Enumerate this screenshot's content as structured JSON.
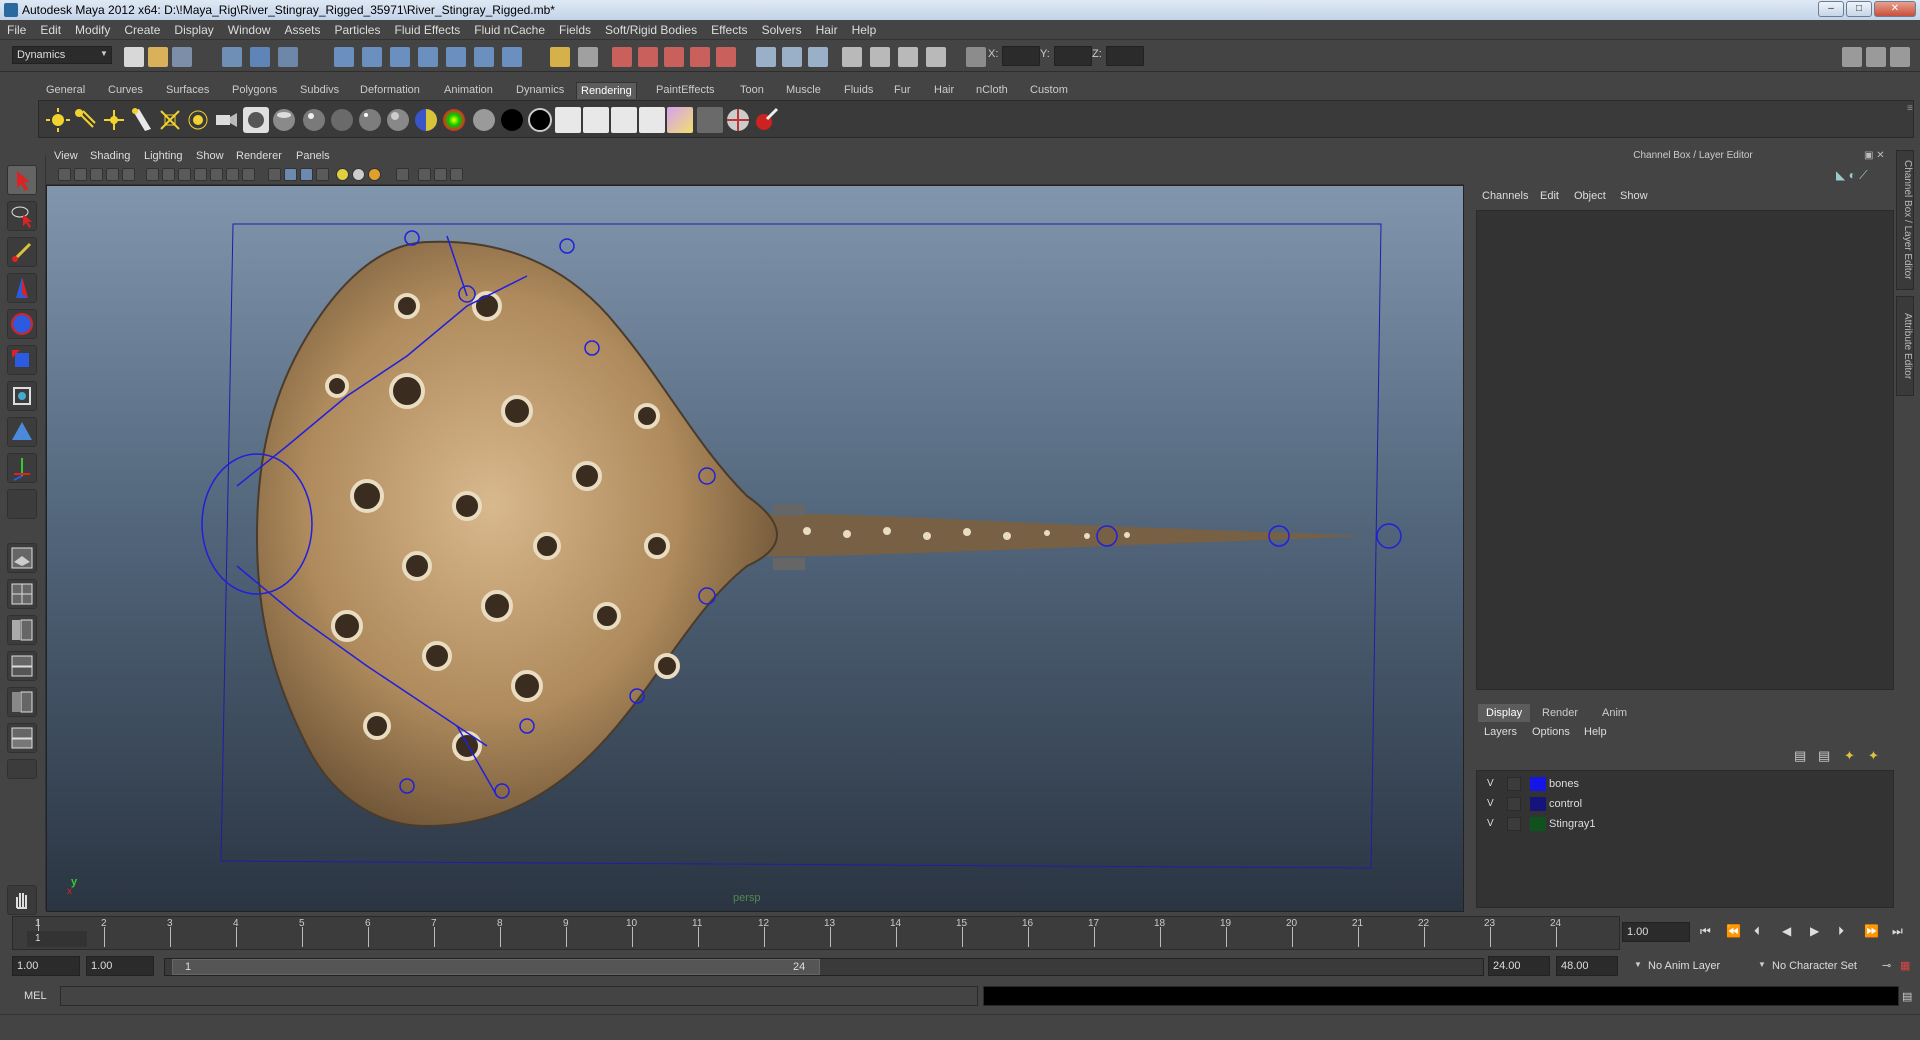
{
  "window": {
    "title": "Autodesk Maya 2012 x64: D:\\!Maya_Rig\\River_Stingray_Rigged_35971\\River_Stingray_Rigged.mb*",
    "minimize": "‒",
    "maximize": "□",
    "close": "✕"
  },
  "menubar": [
    "File",
    "Edit",
    "Modify",
    "Create",
    "Display",
    "Window",
    "Assets",
    "Particles",
    "Fluid Effects",
    "Fluid nCache",
    "Fields",
    "Soft/Rigid Bodies",
    "Effects",
    "Solvers",
    "Hair",
    "Help"
  ],
  "statusline": {
    "mode": "Dynamics",
    "x_label": "X:",
    "y_label": "Y:",
    "z_label": "Z:"
  },
  "shelf_tabs": [
    "General",
    "Curves",
    "Surfaces",
    "Polygons",
    "Subdivs",
    "Deformation",
    "Animation",
    "Dynamics",
    "Rendering",
    "PaintEffects",
    "Toon",
    "Muscle",
    "Fluids",
    "Fur",
    "Hair",
    "nCloth",
    "Custom"
  ],
  "shelf_active": "Rendering",
  "viewport": {
    "menus": [
      "View",
      "Shading",
      "Lighting",
      "Show",
      "Renderer",
      "Panels"
    ],
    "camera": "persp",
    "axis_y": "y",
    "axis_x": "x"
  },
  "channel_box": {
    "header": "Channel Box / Layer Editor",
    "menus": [
      "Channels",
      "Edit",
      "Object",
      "Show"
    ],
    "side_tabs": [
      "Channel Box / Layer Editor",
      "Attribute Editor"
    ]
  },
  "layer_editor": {
    "tabs": [
      "Display",
      "Render",
      "Anim"
    ],
    "active_tab": "Display",
    "menus": [
      "Layers",
      "Options",
      "Help"
    ],
    "layers": [
      {
        "visible": "V",
        "name": "bones",
        "color": "#1515e8"
      },
      {
        "visible": "V",
        "name": "control",
        "color": "#14147a"
      },
      {
        "visible": "V",
        "name": "Stingray1",
        "color": "#10521e"
      }
    ]
  },
  "timeline": {
    "ticks": [
      "1",
      "2",
      "3",
      "4",
      "5",
      "6",
      "7",
      "8",
      "9",
      "10",
      "11",
      "12",
      "13",
      "14",
      "15",
      "16",
      "17",
      "18",
      "19",
      "20",
      "21",
      "22",
      "23",
      "24"
    ],
    "current_frame_label": "1",
    "current_frame": "1.00"
  },
  "range": {
    "start": "1.00",
    "playback_start": "1.00",
    "handle_start": "1",
    "handle_end": "24",
    "playback_end": "24.00",
    "end": "48.00",
    "anim_layer": "No Anim Layer",
    "char_set": "No Character Set"
  },
  "command_line": {
    "label": "MEL",
    "value": ""
  }
}
